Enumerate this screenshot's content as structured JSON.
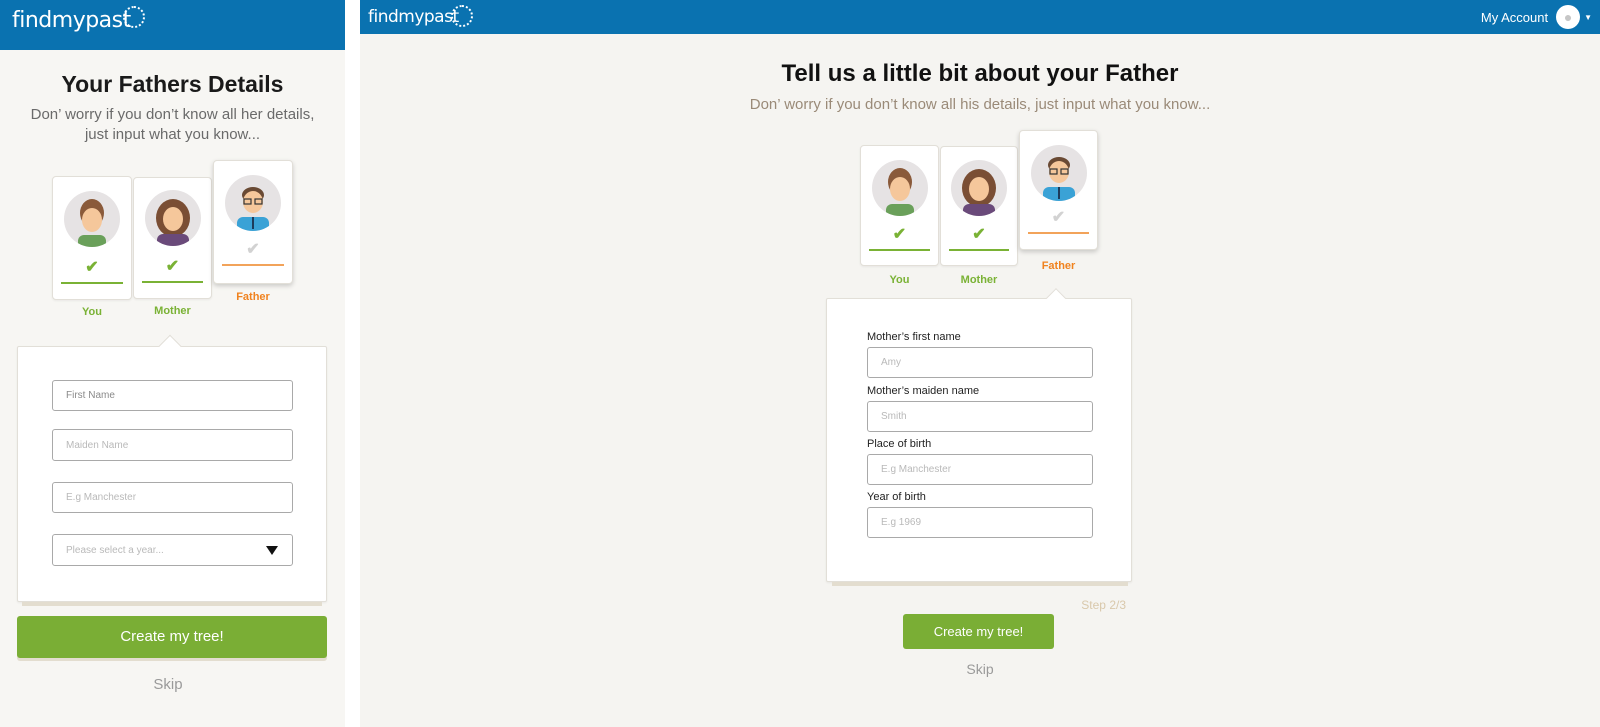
{
  "mobile": {
    "logo": "findmypast",
    "title": "Your Fathers Details",
    "subtitle": "Don’ worry if you don’t know all her details, just input what you know...",
    "steps": [
      {
        "label": "You",
        "state": "done"
      },
      {
        "label": "Mother",
        "state": "done"
      },
      {
        "label": "Father",
        "state": "current"
      }
    ],
    "fields": {
      "first_name_placeholder": "First Name",
      "maiden_name_placeholder": "Maiden Name",
      "place_placeholder": "E.g Manchester",
      "year_placeholder": "Please select a year..."
    },
    "create_button": "Create my tree!",
    "skip": "Skip"
  },
  "desktop": {
    "logo": "findmypast",
    "account_label": "My Account",
    "title": "Tell us a little bit about your Father",
    "subtitle": "Don’ worry if you don’t know all his details, just input what you know...",
    "steps": [
      {
        "label": "You",
        "state": "done"
      },
      {
        "label": "Mother",
        "state": "done"
      },
      {
        "label": "Father",
        "state": "current"
      }
    ],
    "form": {
      "first_name_label": "Mother’s first name",
      "first_name_placeholder": "Amy",
      "maiden_name_label": "Mother’s maiden name",
      "maiden_name_placeholder": "Smith",
      "place_label": "Place of birth",
      "place_placeholder": "E.g Manchester",
      "year_label": "Year of birth",
      "year_placeholder": "E.g 1969"
    },
    "step_indicator": "Step 2/3",
    "create_button": "Create my tree!",
    "skip": "Skip"
  },
  "colors": {
    "brand_blue": "#0a72b0",
    "accent_green": "#7aae35",
    "current_orange": "#f0821e"
  },
  "icons": {
    "check": "check-icon",
    "dropdown": "caret-down-icon",
    "account": "user-icon"
  }
}
